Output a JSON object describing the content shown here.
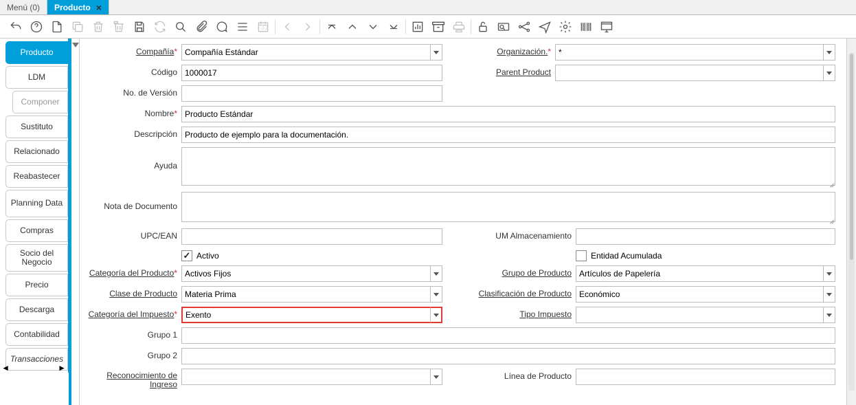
{
  "tabs_strip": {
    "menu": "Menú (0)",
    "active": "Producto"
  },
  "sidebar": [
    {
      "label": "Producto",
      "active": true
    },
    {
      "label": "LDM"
    },
    {
      "label": "Componer",
      "child": true
    },
    {
      "label": "Sustituto"
    },
    {
      "label": "Relacionado"
    },
    {
      "label": "Reabastecer"
    },
    {
      "label": "Planning Data",
      "tall": true
    },
    {
      "label": "Compras"
    },
    {
      "label": "Socio del Negocio",
      "tall": true
    },
    {
      "label": "Precio"
    },
    {
      "label": "Descarga"
    },
    {
      "label": "Contabilidad"
    },
    {
      "label": "Transacciones",
      "italic": true
    }
  ],
  "form": {
    "compania": {
      "label": "Compañía",
      "value": "Compañía Estándar",
      "required": true,
      "underline": true
    },
    "organizacion": {
      "label": "Organización.",
      "value": "*",
      "required": true,
      "underline": true
    },
    "codigo": {
      "label": "Código",
      "value": "1000017"
    },
    "parent_product": {
      "label": "Parent Product",
      "value": "",
      "underline": true
    },
    "no_version": {
      "label": "No. de Versión",
      "value": ""
    },
    "nombre": {
      "label": "Nombre",
      "value": "Producto Estándar",
      "required": true
    },
    "descripcion": {
      "label": "Descripción",
      "value": "Producto de ejemplo para la documentación."
    },
    "ayuda": {
      "label": "Ayuda",
      "value": ""
    },
    "nota_doc": {
      "label": "Nota de Documento",
      "value": ""
    },
    "upc_ean": {
      "label": "UPC/EAN",
      "value": ""
    },
    "um_almacen": {
      "label": "UM Almacenamiento",
      "value": ""
    },
    "activo": {
      "label": "Activo",
      "checked": true
    },
    "entidad_acum": {
      "label": "Entidad Acumulada",
      "checked": false
    },
    "cat_producto": {
      "label": "Categoría del Producto",
      "value": "Activos Fijos",
      "required": true,
      "underline": true
    },
    "grupo_producto": {
      "label": "Grupo de Producto",
      "value": "Artículos de Papelería",
      "underline": true
    },
    "clase_producto": {
      "label": "Clase de Producto",
      "value": "Materia Prima",
      "underline": true
    },
    "clasif_producto": {
      "label": "Clasificación de Producto",
      "value": "Económico",
      "underline": true
    },
    "cat_impuesto": {
      "label": "Categoría del Impuesto",
      "value": "Exento",
      "required": true,
      "underline": true,
      "highlight": true
    },
    "tipo_impuesto": {
      "label": "Tipo Impuesto",
      "value": "",
      "underline": true
    },
    "grupo1": {
      "label": "Grupo 1",
      "value": ""
    },
    "grupo2": {
      "label": "Grupo 2",
      "value": ""
    },
    "reconocimiento": {
      "label": "Reconocimiento de Ingreso",
      "value": "",
      "underline": true
    },
    "linea_producto": {
      "label": "Línea de Producto",
      "value": ""
    }
  }
}
